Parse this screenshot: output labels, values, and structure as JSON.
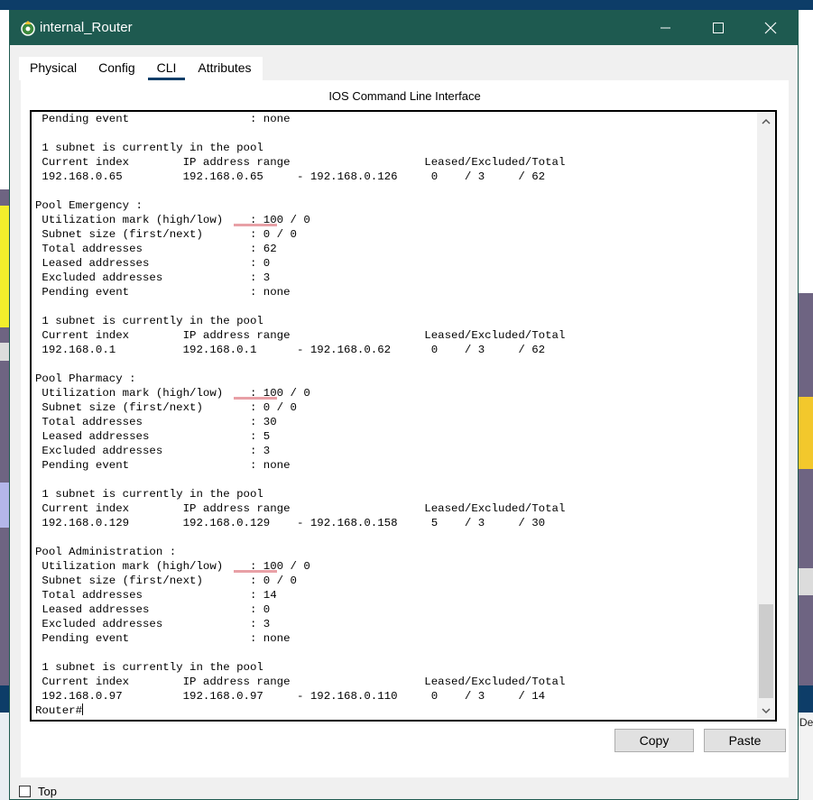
{
  "window": {
    "title": "internal_Router"
  },
  "tabs": [
    {
      "label": "Physical"
    },
    {
      "label": "Config"
    },
    {
      "label": "CLI"
    },
    {
      "label": "Attributes"
    }
  ],
  "panel": {
    "title": "IOS Command Line Interface"
  },
  "cli_lines": [
    " Pending event                  : none",
    "",
    " 1 subnet is currently in the pool",
    " Current index        IP address range                    Leased/Excluded/Total",
    " 192.168.0.65         192.168.0.65     - 192.168.0.126     0    / 3     / 62",
    "",
    "Pool Emergency :",
    " Utilization mark (high/low)    : 100 / 0",
    " Subnet size (first/next)       : 0 / 0",
    " Total addresses                : 62",
    " Leased addresses               : 0",
    " Excluded addresses             : 3",
    " Pending event                  : none",
    "",
    " 1 subnet is currently in the pool",
    " Current index        IP address range                    Leased/Excluded/Total",
    " 192.168.0.1          192.168.0.1      - 192.168.0.62      0    / 3     / 62",
    "",
    "Pool Pharmacy :",
    " Utilization mark (high/low)    : 100 / 0",
    " Subnet size (first/next)       : 0 / 0",
    " Total addresses                : 30",
    " Leased addresses               : 5",
    " Excluded addresses             : 3",
    " Pending event                  : none",
    "",
    " 1 subnet is currently in the pool",
    " Current index        IP address range                    Leased/Excluded/Total",
    " 192.168.0.129        192.168.0.129    - 192.168.0.158     5    / 3     / 30",
    "",
    "Pool Administration :",
    " Utilization mark (high/low)    : 100 / 0",
    " Subnet size (first/next)       : 0 / 0",
    " Total addresses                : 14",
    " Leased addresses               : 0",
    " Excluded addresses             : 3",
    " Pending event                  : none",
    "",
    " 1 subnet is currently in the pool",
    " Current index        IP address range                    Leased/Excluded/Total",
    " 192.168.0.97         192.168.0.97     - 192.168.0.110     0    / 3     / 14",
    "Router#"
  ],
  "buttons": {
    "copy": "Copy",
    "paste": "Paste"
  },
  "top_checkbox": {
    "label": "Top",
    "checked": false
  },
  "background": {
    "side_text": "De"
  },
  "colors": {
    "titlebar": "#1e5a50",
    "tab_underline": "#0d3d68",
    "highlight": "#e8a0a6"
  }
}
